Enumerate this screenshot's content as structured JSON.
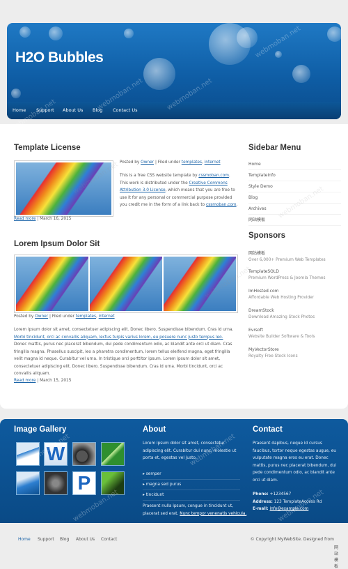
{
  "site": {
    "logo": "H2O Bubbles"
  },
  "nav": [
    "Home",
    "Support",
    "About Us",
    "Blog",
    "Contact Us"
  ],
  "posts": [
    {
      "title": "Template License",
      "posted_by_prefix": "Posted by",
      "author": "Owner",
      "filed_under": "| Filed under",
      "tag1": "templates",
      "tag2": "internet",
      "text_a": "This is a free CSS website template by",
      "link1": "cssmoban.com",
      "text_b": ". This work is distributed under the",
      "link2": "Creative Commons Attribution 3.0 License",
      "text_c": ", which means that you are free to use it for any personal or commercial purpose provided you credit me in the form of a link back to",
      "link3": "cssmoban.com",
      "read_more": "Read more",
      "date": "| March 16, 2015"
    },
    {
      "title": "Lorem Ipsum Dolor Sit",
      "posted_by_prefix": "Posted by",
      "author": "Owner",
      "filed_under": "| Filed under",
      "tag1": "templates",
      "tag2": "internet",
      "text_a": "Lorem ipsum dolor sit amet, consectetuer adipiscing elit. Donec libero. Suspendisse bibendum. Cras id urna.",
      "link1": "Morbi tincidunt, orci ac convallis aliquam, lectus turpis varius lorem, eu posuere nunc justo tempus leo.",
      "text_b": "Donec mattis, purus nec placerat bibendum, dui pede condimentum odio, ac blandit ante orci ut diam. Cras fringilla magna. Phasellus suscipit, leo a pharetra condimentum, lorem tellus eleifend magna, eget fringilla velit magna id neque. Curabitur vel urna. In tristique orci porttitor ipsum. Lorem ipsum dolor sit amet, consectetuer adipiscing elit. Donec libero. Suspendisse bibendum. Cras id urna. Morbi tincidunt, orci ac convallis aliquam.",
      "read_more": "Read more",
      "date": "| March 15, 2015"
    }
  ],
  "sidebar": {
    "menu_title": "Sidebar Menu",
    "menu": [
      "Home",
      "TemplateInfo",
      "Style Demo",
      "Blog",
      "Archives",
      "网站模板"
    ],
    "sponsors_title": "Sponsors",
    "sponsors": [
      {
        "name": "网站模板",
        "desc": "Over 6,000+ Premium Web Templates"
      },
      {
        "name": "TemplateSOLD",
        "desc": "Premium WordPress & Joomla Themes"
      },
      {
        "name": "ImHosted.com",
        "desc": "Affordable Web Hosting Provider"
      },
      {
        "name": "DreamStock",
        "desc": "Download Amazing Stock Photos"
      },
      {
        "name": "Evrsoft",
        "desc": "Website Builder Software & Tools"
      },
      {
        "name": "MyVectorStore",
        "desc": "Royalty Free Stock Icons"
      }
    ]
  },
  "footer": {
    "gallery_title": "Image Gallery",
    "about_title": "About",
    "about_text": "Lorem ipsum dolor sit amet, consectetur adipiscing elit. Curabitur dui nunc, molestie ut porta et, egestas vel justo.",
    "about_list": [
      "semper",
      "magna sed purus",
      "tincidunt"
    ],
    "about_text2": "Praesent nulla ipsum, congue in tincidunt ut, placerat sed erat.",
    "about_link": "Nunc tempor venenatis vehicula.",
    "contact_title": "Contact",
    "contact_text": "Praesent dapibus, neque id cursus faucibus, tortor neque egestas augue, eu vulputate magna eros eu erat. Donec mattis, purus nec placerat bibendum, dui pede condimentum odio, ac blandit ante orci ut diam.",
    "phone_label": "Phone:",
    "phone": "+1234567",
    "address_label": "Address:",
    "address": "123 TemplateAccess Rd",
    "email_label": "E-mail:",
    "email": "info@example.com"
  },
  "bottom": {
    "nav": [
      "Home",
      "Support",
      "Blog",
      "About Us",
      "Contact"
    ],
    "copyright": "© Copyright MyWebSite. Designed from",
    "designer": "网站模板"
  },
  "watermark": "webmoban.net",
  "colors": {
    "accent": "#1a63a8",
    "header": "#1f79c4",
    "footer": "#0e5a9e"
  }
}
